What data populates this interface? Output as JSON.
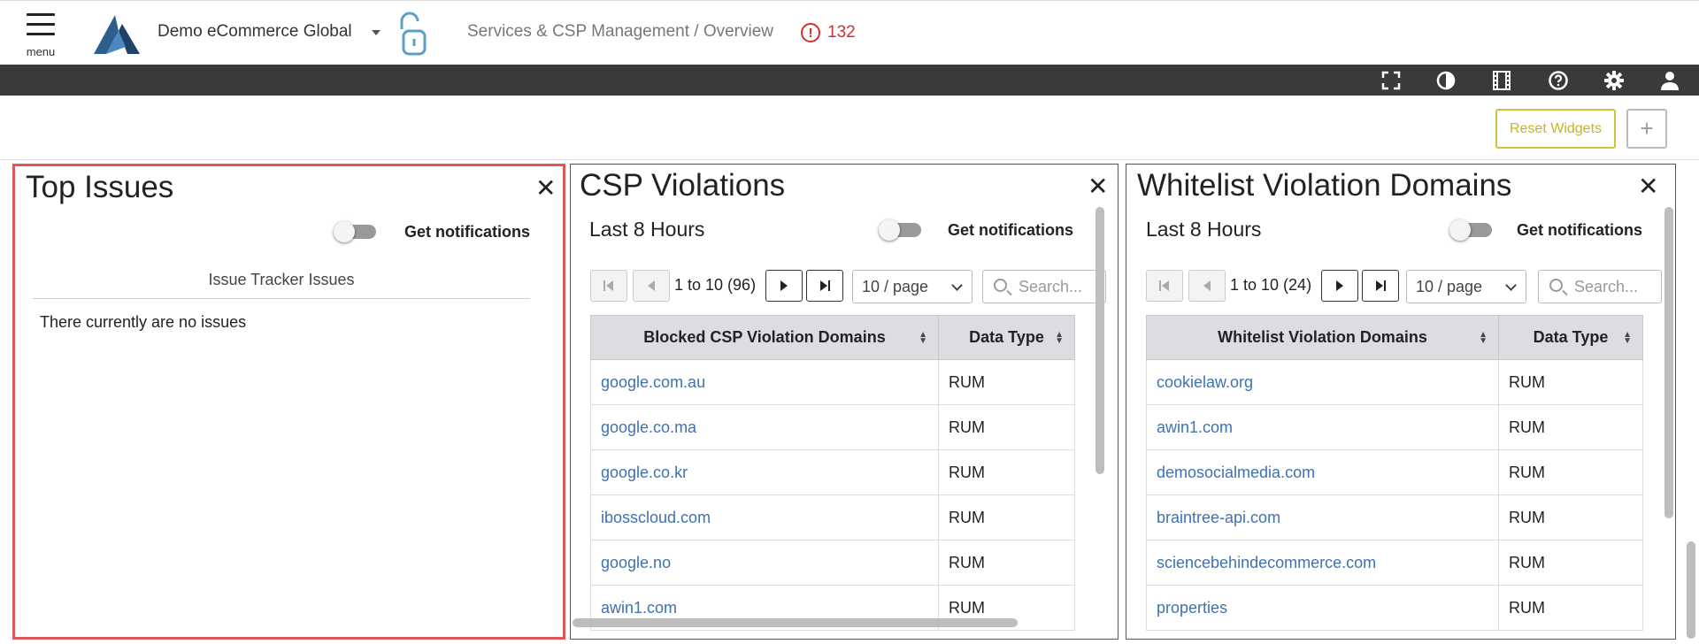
{
  "header": {
    "menu_label": "menu",
    "org_name": "Demo eCommerce Global",
    "breadcrumb": "Services & CSP Management / Overview",
    "alert_count": "132",
    "alert_color": "#d32f2f"
  },
  "toolbar": {
    "icons": [
      "fullscreen-icon",
      "contrast-icon",
      "film-icon",
      "help-icon",
      "settings-icon",
      "user-icon"
    ]
  },
  "actions": {
    "reset_label": "Reset Widgets",
    "add_label": "+"
  },
  "widgets": {
    "top_issues": {
      "title": "Top Issues",
      "close": "✕",
      "notifications_label": "Get notifications",
      "tracker_header": "Issue Tracker Issues",
      "empty_message": "There currently are no issues"
    },
    "csp": {
      "title": "CSP Violations",
      "close": "✕",
      "period": "Last 8 Hours",
      "notifications_label": "Get notifications",
      "page_info": "1 to 10 (96)",
      "page_size": "10 / page",
      "search_placeholder": "Search...",
      "columns": [
        "Blocked CSP Violation Domains",
        "Data Type"
      ],
      "rows": [
        [
          "google.com.au",
          "RUM"
        ],
        [
          "google.co.ma",
          "RUM"
        ],
        [
          "google.co.kr",
          "RUM"
        ],
        [
          "ibosscloud.com",
          "RUM"
        ],
        [
          "google.no",
          "RUM"
        ],
        [
          "awin1.com",
          "RUM"
        ]
      ]
    },
    "whitelist": {
      "title": "Whitelist Violation Domains",
      "close": "✕",
      "period": "Last 8 Hours",
      "notifications_label": "Get notifications",
      "page_info": "1 to 10 (24)",
      "page_size": "10 / page",
      "search_placeholder": "Search...",
      "columns": [
        "Whitelist Violation Domains",
        "Data Type"
      ],
      "rows": [
        [
          "cookielaw.org",
          "RUM"
        ],
        [
          "awin1.com",
          "RUM"
        ],
        [
          "demosocialmedia.com",
          "RUM"
        ],
        [
          "braintree-api.com",
          "RUM"
        ],
        [
          "sciencebehindecommerce.com",
          "RUM"
        ],
        [
          "properties",
          "RUM"
        ]
      ]
    }
  }
}
